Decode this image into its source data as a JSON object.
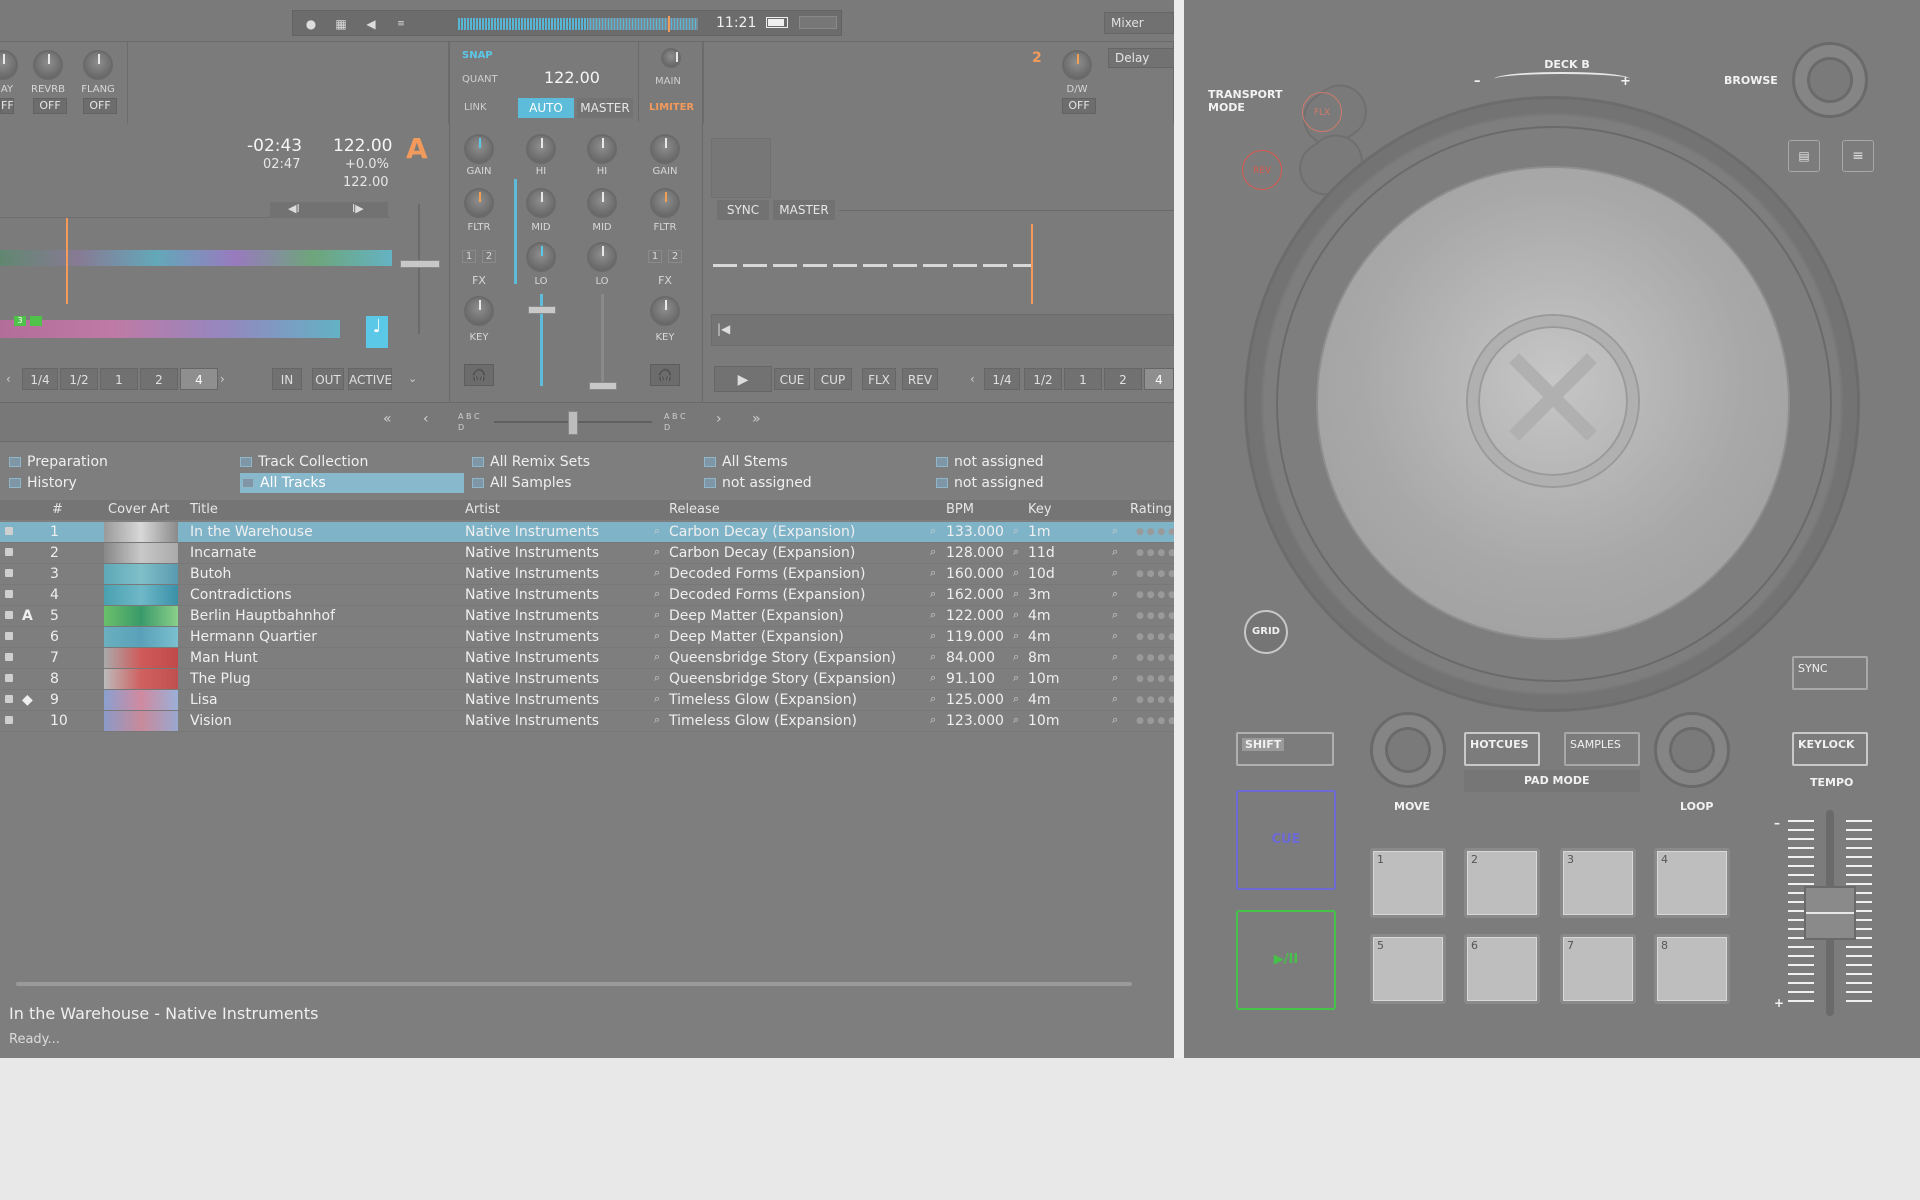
{
  "topbar": {
    "time": "11:21",
    "mixer_label": "Mixer",
    "icons": [
      "record-icon",
      "grid-icon",
      "speaker-icon",
      "load-icon",
      "battery-icon"
    ],
    "meter_accent": "#58b6d4"
  },
  "fx_left": {
    "units": [
      {
        "label": "AY",
        "state": "FF"
      },
      {
        "label": "REVRB",
        "state": "OFF"
      },
      {
        "label": "FLANG",
        "state": "OFF"
      }
    ]
  },
  "fx_right": {
    "unit_num": "2",
    "effect": "Delay",
    "knob_label": "D/W",
    "state": "OFF"
  },
  "mixer": {
    "snap": "SNAP",
    "quant": "QUANT",
    "bpm": "122.00",
    "link": "LINK",
    "auto": "AUTO",
    "master": "MASTER",
    "main": "MAIN",
    "limiter": "LIMITER",
    "ch_labels": [
      "GAIN",
      "HI",
      "MID",
      "LO",
      "FLTR",
      "FX",
      "KEY"
    ],
    "ch_assign": [
      "1",
      "2"
    ],
    "xf_left": "A B C D",
    "xf_right": "A B C D"
  },
  "deckA": {
    "letter": "A",
    "remain": "-02:43",
    "elapsed": "02:47",
    "bpm": "122.00",
    "pitch": "+0.0%",
    "base_bpm": "122.00",
    "loop_sizes": [
      "1/4",
      "1/2",
      "1",
      "2",
      "4"
    ],
    "loop_active": "4",
    "loop_controls": [
      "IN",
      "OUT",
      "ACTIVE"
    ],
    "cue_marker": "3"
  },
  "deckB": {
    "sync": "SYNC",
    "master": "MASTER",
    "transport": [
      "CUE",
      "CUP",
      "FLX",
      "REV"
    ],
    "loop_sizes": [
      "1/4",
      "1/2",
      "1",
      "2",
      "4"
    ],
    "loop_active": "4"
  },
  "browser": {
    "favorites": [
      {
        "label": "Preparation"
      },
      {
        "label": "Track Collection"
      },
      {
        "label": "All Remix Sets"
      },
      {
        "label": "All Stems"
      },
      {
        "label": "not assigned"
      },
      {
        "label": "History"
      },
      {
        "label": "All Tracks",
        "selected": true
      },
      {
        "label": "All Samples"
      },
      {
        "label": "not assigned"
      },
      {
        "label": "not assigned"
      }
    ],
    "columns": [
      "#",
      "Cover Art",
      "Title",
      "Artist",
      "Release",
      "BPM",
      "Key",
      "Rating"
    ],
    "rows": [
      {
        "num": "1",
        "title": "In the Warehouse",
        "artist": "Native Instruments",
        "release": "Carbon Decay (Expansion)",
        "bpm": "133.000",
        "key": "1m",
        "flag": "",
        "selected": true
      },
      {
        "num": "2",
        "title": "Incarnate",
        "artist": "Native Instruments",
        "release": "Carbon Decay (Expansion)",
        "bpm": "128.000",
        "key": "11d",
        "flag": ""
      },
      {
        "num": "3",
        "title": "Butoh",
        "artist": "Native Instruments",
        "release": "Decoded Forms (Expansion)",
        "bpm": "160.000",
        "key": "10d",
        "flag": ""
      },
      {
        "num": "4",
        "title": "Contradictions",
        "artist": "Native Instruments",
        "release": "Decoded Forms (Expansion)",
        "bpm": "162.000",
        "key": "3m",
        "flag": ""
      },
      {
        "num": "5",
        "title": "Berlin Hauptbahnhof",
        "artist": "Native Instruments",
        "release": "Deep Matter (Expansion)",
        "bpm": "122.000",
        "key": "4m",
        "flag": "A"
      },
      {
        "num": "6",
        "title": "Hermann Quartier",
        "artist": "Native Instruments",
        "release": "Deep Matter (Expansion)",
        "bpm": "119.000",
        "key": "4m",
        "flag": ""
      },
      {
        "num": "7",
        "title": "Man Hunt",
        "artist": "Native Instruments",
        "release": "Queensbridge Story (Expansion)",
        "bpm": "84.000",
        "key": "8m",
        "flag": ""
      },
      {
        "num": "8",
        "title": "The Plug",
        "artist": "Native Instruments",
        "release": "Queensbridge Story (Expansion)",
        "bpm": "91.100",
        "key": "10m",
        "flag": ""
      },
      {
        "num": "9",
        "title": "Lisa",
        "artist": "Native Instruments",
        "release": "Timeless Glow (Expansion)",
        "bpm": "125.000",
        "key": "4m",
        "flag": "◆"
      },
      {
        "num": "10",
        "title": "Vision",
        "artist": "Native Instruments",
        "release": "Timeless Glow (Expansion)",
        "bpm": "123.000",
        "key": "10m",
        "flag": ""
      }
    ],
    "status_track": "In  the Warehouse - Native Instruments",
    "status_msg": "Ready..."
  },
  "controller": {
    "deck": "DECK B",
    "deck_minus": "–",
    "deck_plus": "+",
    "transport_mode": "TRANSPORT MODE",
    "flx": "FLX",
    "rev": "REV",
    "browse": "BROWSE",
    "grid": "GRID",
    "sync": "SYNC",
    "shift": "SHIFT",
    "hotcues": "HOTCUES",
    "samples": "SAMPLES",
    "keylock": "KEYLOCK",
    "pad_mode": "PAD MODE",
    "move": "MOVE",
    "loop": "LOOP",
    "tempo": "TEMPO",
    "cue": "CUE",
    "play": "▶/II",
    "tempo_minus": "–",
    "tempo_plus": "+",
    "pads": [
      "1",
      "2",
      "3",
      "4",
      "5",
      "6",
      "7",
      "8"
    ],
    "accents": {
      "cue": "#6d6ad8",
      "play": "#46c24a",
      "flx": "#e07a6a",
      "rev": "#d9584d"
    }
  }
}
